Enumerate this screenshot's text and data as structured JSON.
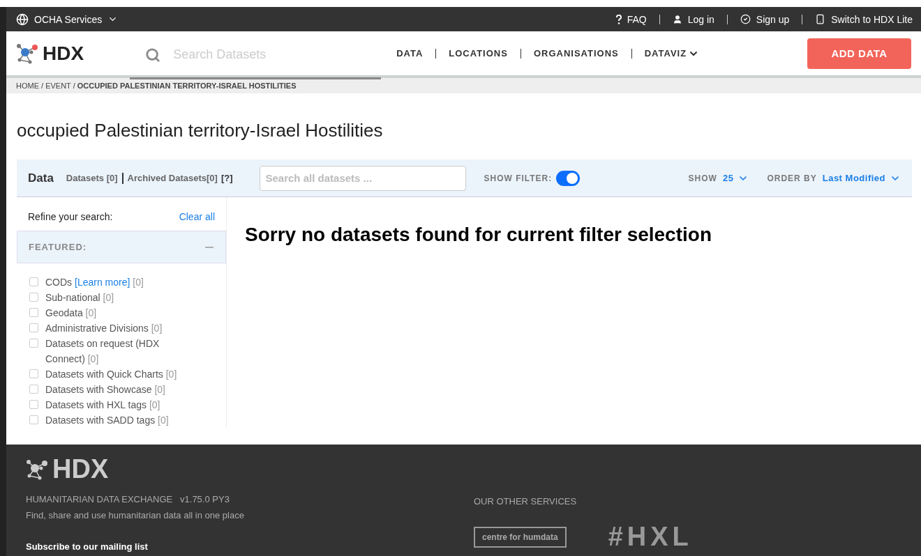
{
  "top_bar": {
    "services": "OCHA Services",
    "links": [
      {
        "kind": "faq",
        "label": "FAQ"
      },
      {
        "kind": "login",
        "label": "Log in"
      },
      {
        "kind": "signup",
        "label": "Sign up"
      },
      {
        "kind": "lite",
        "label": "Switch to HDX Lite"
      }
    ]
  },
  "header": {
    "logo": "HDX",
    "search": {
      "placeholder": "Search Datasets"
    },
    "nav": [
      {
        "label": "DATA",
        "dropdown": false
      },
      {
        "label": "LOCATIONS",
        "dropdown": false
      },
      {
        "label": "ORGANISATIONS",
        "dropdown": false
      },
      {
        "label": "DATAVIZ",
        "dropdown": true
      }
    ],
    "add_button": "ADD DATA"
  },
  "breadcrumb": "HOME / EVENT / **OCCUPIED PALESTINIAN TERRITORY-ISRAEL HOSTILITIES**",
  "title": "occupied Palestinian territory-Israel Hostilities",
  "data_bar": {
    "label": "Data",
    "datasets": "Datasets [0]",
    "archived": "Archived Datasets[0]",
    "help": "[?]",
    "search": {
      "placeholder": "Search all datasets ..."
    },
    "show_filter": {
      "label": "SHOW FILTER:",
      "on": true
    },
    "show": {
      "label": "SHOW",
      "value": "25"
    },
    "order": {
      "label": "ORDER BY",
      "value": "Last Modified"
    }
  },
  "sidebar": {
    "refine": "Refine your search:",
    "clear": "Clear all",
    "section": {
      "title": "FEATURED:",
      "expanded": true
    },
    "filters": [
      {
        "label": "CODs",
        "link": "[Learn more]",
        "count": "[0]",
        "checked": false
      },
      {
        "label": "Sub-national",
        "count": "[0]",
        "checked": false
      },
      {
        "label": "Geodata",
        "count": "[0]",
        "checked": false
      },
      {
        "label": "Administrative Divisions",
        "count": "[0]",
        "checked": false
      },
      {
        "label": "Datasets on request (HDX Connect)",
        "count": "[0]",
        "checked": false
      },
      {
        "label": "Datasets with Quick Charts",
        "count": "[0]",
        "checked": false
      },
      {
        "label": "Datasets with Showcase",
        "count": "[0]",
        "checked": false
      },
      {
        "label": "Datasets with HXL tags",
        "count": "[0]",
        "checked": false
      },
      {
        "label": "Datasets with SADD tags",
        "count": "[0]",
        "checked": false
      }
    ]
  },
  "message": "Sorry no datasets found for current filter selection",
  "footer": {
    "logo": "HDX",
    "name": "HUMANITARIAN DATA EXCHANGE",
    "version": "v1.75.0 PY3",
    "tagline": "Find, share and use humanitarian data all in one place",
    "subscribe": "Subscribe to our mailing list",
    "other_title": "OUR OTHER SERVICES",
    "centre": "centre for humdata",
    "hxl": "#HXL"
  }
}
